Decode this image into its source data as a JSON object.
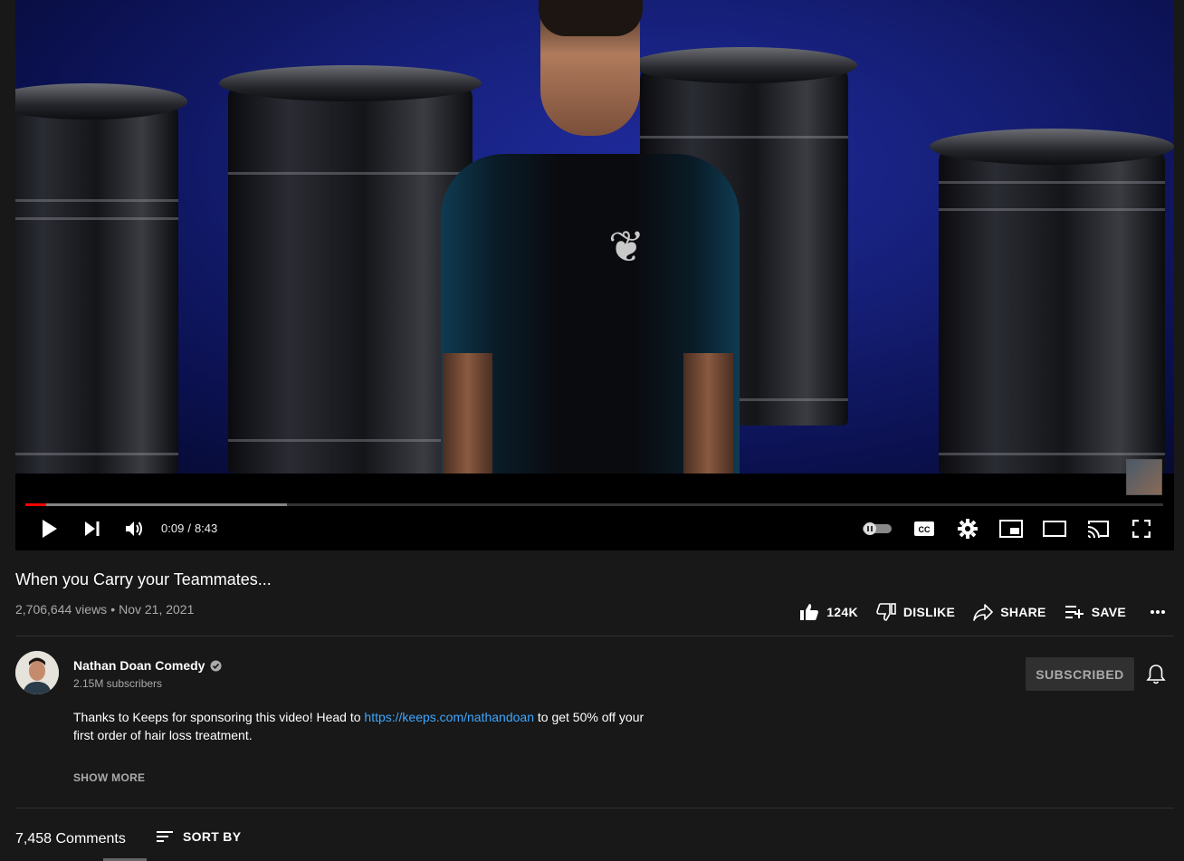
{
  "player": {
    "time_current": "0:09",
    "time_total": "8:43",
    "time_sep": "/",
    "progress_played_fraction": 0.018,
    "progress_loaded_fraction": 0.23,
    "icons": [
      "play-icon",
      "next-icon",
      "volume-icon",
      "autoplay-toggle-icon",
      "captions-icon",
      "settings-icon",
      "miniplayer-icon",
      "theater-mode-icon",
      "cast-icon",
      "fullscreen-icon"
    ]
  },
  "video": {
    "title": "When you Carry your Teammates...",
    "views": "2,706,644 views",
    "dot": "•",
    "date": "Nov 21, 2021"
  },
  "actions": {
    "like": "124K",
    "dislike": "DISLIKE",
    "share": "SHARE",
    "save": "SAVE"
  },
  "channel": {
    "name": "Nathan Doan Comedy",
    "subscribers": "2.15M subscribers",
    "subscribe_label": "SUBSCRIBED"
  },
  "description": {
    "text_before": "Thanks to Keeps for sponsoring this video! Head to ",
    "link": "https://keeps.com/nathandoan",
    "text_after": " to get 50% off your first order of hair loss treatment.",
    "show_more": "SHOW MORE"
  },
  "comments": {
    "count": "7,458 Comments",
    "sort_label": "SORT BY"
  },
  "colors": {
    "background": "#181818",
    "link": "#3ea6ff",
    "progress_played": "#ff0000",
    "muted_text": "#aaaaaa"
  }
}
